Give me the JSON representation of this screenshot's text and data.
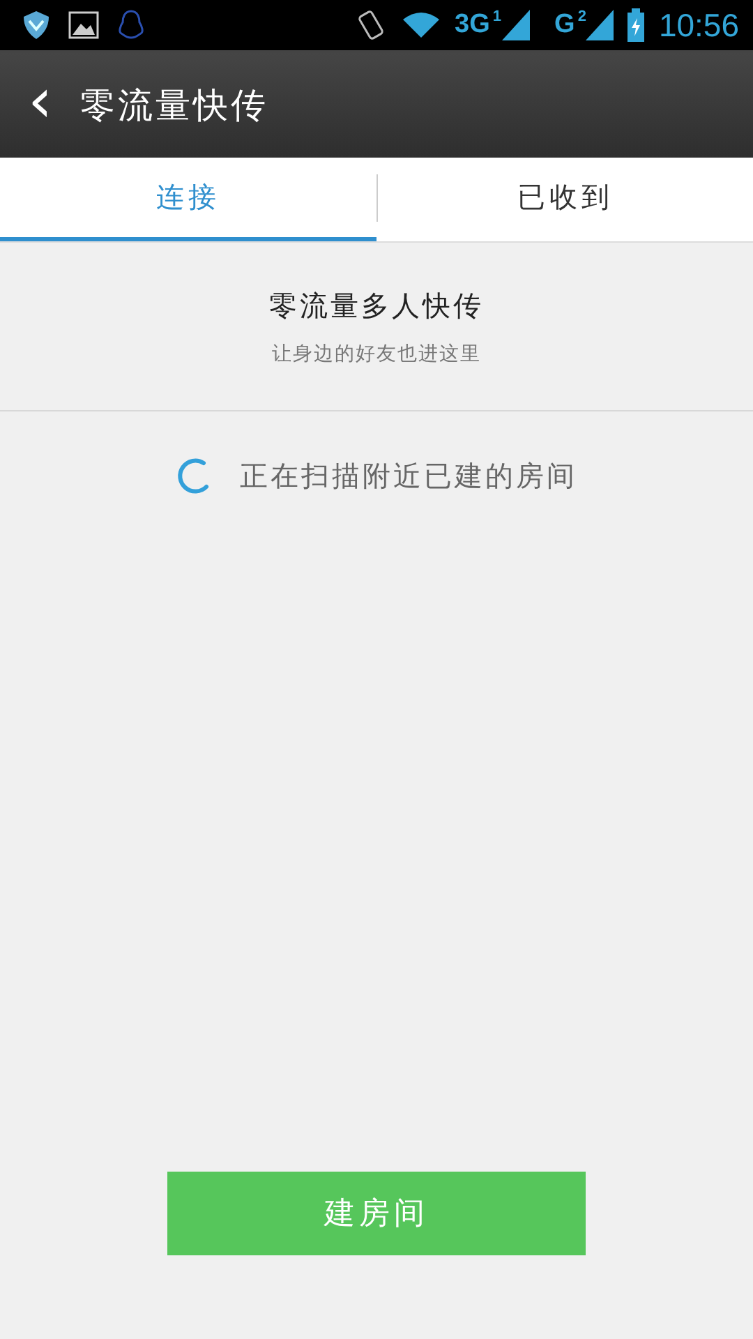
{
  "status_bar": {
    "network_1": "3G",
    "sim_1": "1",
    "network_2": "G",
    "sim_2": "2",
    "time": "10:56"
  },
  "header": {
    "back": "‹",
    "title": "零流量快传"
  },
  "tabs": [
    {
      "label": "连接",
      "selected": true
    },
    {
      "label": "已收到",
      "selected": false
    }
  ],
  "intro": {
    "title": "零流量多人快传",
    "subtitle": "让身边的好友也进这里"
  },
  "scan": {
    "loading": true,
    "text": "正在扫描附近已建的房间"
  },
  "button": "建房间"
}
